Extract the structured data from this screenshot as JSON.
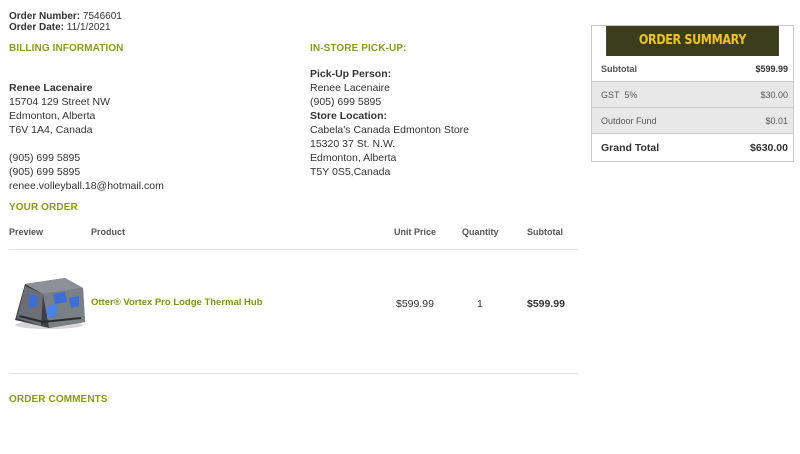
{
  "order": {
    "number_label": "Order Number:",
    "number": "7546601",
    "date_label": "Order Date:",
    "date": "11/1/2021"
  },
  "billing": {
    "title": "BILLING INFORMATION",
    "name": "Renee Lacenaire",
    "street": "15704 129 Street NW",
    "city": "Edmonton, Alberta",
    "postal": "T6V 1A4, Canada",
    "phone1": "(905) 699 5895",
    "phone2": "(905) 699 5895",
    "email": "renee.volleyball.18@hotmail.com"
  },
  "pickup": {
    "title": "IN-STORE PICK-UP:",
    "person_label": "Pick-Up Person:",
    "person": "Renee Lacenaire",
    "phone": "(905) 699 5895",
    "location_label": "Store Location:",
    "store": "Cabela's Canada Edmonton Store",
    "street": "15320 37 St. N.W.",
    "city": "Edmonton, Alberta",
    "postal": "T5Y 0S5,Canada"
  },
  "your_order": {
    "title": "YOUR ORDER",
    "columns": {
      "preview": "Preview",
      "product": "Product",
      "unit_price": "Unit Price",
      "quantity": "Quantity",
      "subtotal": "Subtotal"
    },
    "items": [
      {
        "product": "Otter® Vortex Pro Lodge Thermal Hub",
        "unit_price": "$599.99",
        "quantity": "1",
        "subtotal": "$599.99"
      }
    ]
  },
  "comments": {
    "title": "ORDER COMMENTS"
  },
  "summary": {
    "title": "ORDER SUMMARY",
    "rows": [
      {
        "label": "Subtotal",
        "value": "$599.99"
      },
      {
        "label": "GST  5%",
        "value": "$30.00"
      },
      {
        "label": "Outdoor Fund",
        "value": "$0.01"
      }
    ],
    "grand_total_label": "Grand Total",
    "grand_total": "$630.00"
  },
  "colors": {
    "accent": "#8a9a1c",
    "summary_header_bg": "#3b3d1c",
    "summary_header_text": "#f2c22b"
  }
}
